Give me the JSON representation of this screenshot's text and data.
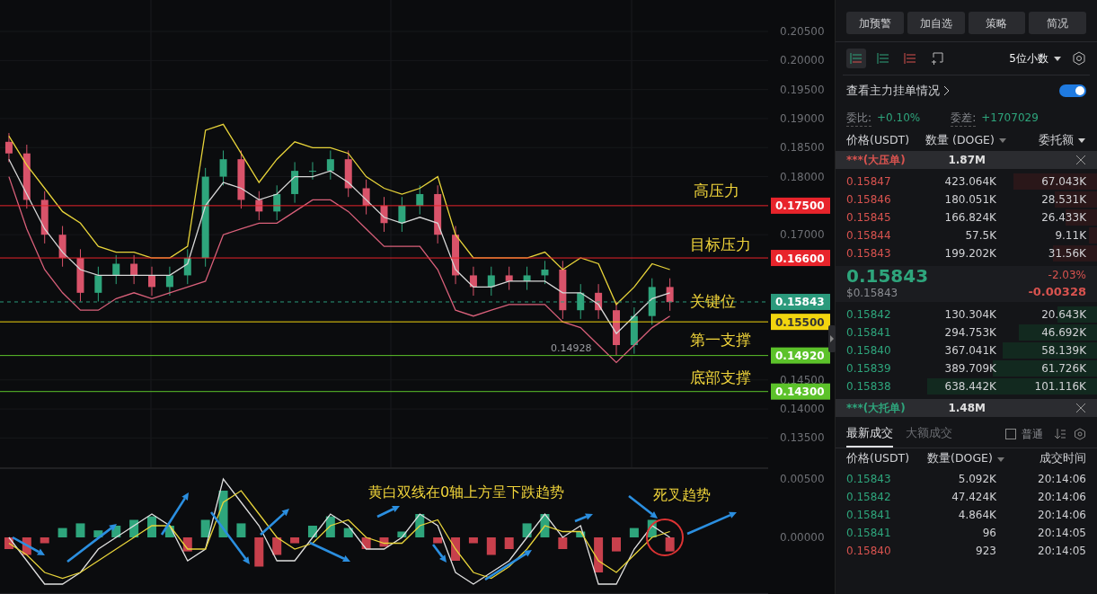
{
  "main_chart": {
    "chart_data": {
      "type": "candlestick",
      "grid": true,
      "categories": [
        null,
        null,
        null,
        null,
        null,
        null,
        null,
        null,
        null,
        null,
        null,
        null,
        null,
        null,
        null,
        null,
        null,
        null,
        null,
        null,
        null,
        null,
        null,
        null,
        null,
        null,
        null,
        null,
        null,
        null,
        null,
        null,
        null,
        null,
        null,
        null,
        null,
        null,
        null,
        null,
        null,
        null,
        null
      ],
      "ohlc": [
        [
          0.186,
          0.1875,
          0.1825,
          0.184
        ],
        [
          0.184,
          0.1855,
          0.1745,
          0.176
        ],
        [
          0.176,
          0.1775,
          0.1685,
          0.17
        ],
        [
          0.17,
          0.1715,
          0.1645,
          0.166
        ],
        [
          0.166,
          0.1675,
          0.1585,
          0.16
        ],
        [
          0.16,
          0.1645,
          0.1585,
          0.163
        ],
        [
          0.163,
          0.1665,
          0.1615,
          0.165
        ],
        [
          0.165,
          0.1665,
          0.1615,
          0.163
        ],
        [
          0.163,
          0.1645,
          0.1595,
          0.161
        ],
        [
          0.161,
          0.1645,
          0.1595,
          0.163
        ],
        [
          0.163,
          0.1675,
          0.1615,
          0.166
        ],
        [
          0.166,
          0.1815,
          0.1645,
          0.18
        ],
        [
          0.18,
          0.1845,
          0.1785,
          0.183
        ],
        [
          0.183,
          0.1845,
          0.1745,
          0.176
        ],
        [
          0.176,
          0.1775,
          0.1725,
          0.174
        ],
        [
          0.174,
          0.1785,
          0.1725,
          0.177
        ],
        [
          0.177,
          0.1825,
          0.1755,
          0.181
        ],
        [
          0.181,
          0.1825,
          0.1795,
          0.181
        ],
        [
          0.181,
          0.1845,
          0.1795,
          0.183
        ],
        [
          0.183,
          0.1845,
          0.1765,
          0.178
        ],
        [
          0.178,
          0.1795,
          0.1735,
          0.175
        ],
        [
          0.175,
          0.1765,
          0.1705,
          0.172
        ],
        [
          0.172,
          0.1765,
          0.1705,
          0.175
        ],
        [
          0.175,
          0.1785,
          0.1735,
          0.177
        ],
        [
          0.177,
          0.1785,
          0.1685,
          0.17
        ],
        [
          0.17,
          0.1715,
          0.1615,
          0.163
        ],
        [
          0.163,
          0.1645,
          0.1595,
          0.161
        ],
        [
          0.161,
          0.1645,
          0.1595,
          0.163
        ],
        [
          0.163,
          0.1645,
          0.1605,
          0.162
        ],
        [
          0.162,
          0.1645,
          0.1605,
          0.163
        ],
        [
          0.163,
          0.1655,
          0.1615,
          0.164
        ],
        [
          0.164,
          0.1655,
          0.1555,
          0.157
        ],
        [
          0.157,
          0.1615,
          0.1555,
          0.16
        ],
        [
          0.16,
          0.1615,
          0.1555,
          0.157
        ],
        [
          0.157,
          0.1585,
          0.1493,
          0.151
        ],
        [
          0.151,
          0.1575,
          0.1495,
          0.156
        ],
        [
          0.156,
          0.1625,
          0.1545,
          0.161
        ],
        [
          0.161,
          0.1625,
          0.1569,
          0.1584
        ],
        null,
        null,
        null,
        null,
        null
      ],
      "series": [
        {
          "type": "line",
          "color": "#e8d43a",
          "values": [
            0.187,
            0.182,
            0.178,
            0.174,
            0.172,
            0.168,
            0.167,
            0.167,
            0.166,
            0.166,
            0.168,
            0.188,
            0.189,
            0.184,
            0.179,
            0.183,
            0.186,
            0.185,
            0.185,
            0.184,
            0.18,
            0.178,
            0.177,
            0.178,
            0.18,
            0.17,
            0.166,
            0.166,
            0.166,
            0.166,
            0.167,
            0.164,
            0.166,
            0.165,
            0.158,
            0.161,
            0.165,
            0.164,
            null,
            null,
            null,
            null,
            null
          ]
        },
        {
          "type": "line",
          "color": "#d8d8d8",
          "values": [
            0.183,
            0.177,
            0.171,
            0.167,
            0.164,
            0.163,
            0.163,
            0.163,
            0.163,
            0.163,
            0.165,
            0.175,
            0.179,
            0.178,
            0.176,
            0.177,
            0.18,
            0.18,
            0.181,
            0.179,
            0.176,
            0.173,
            0.172,
            0.173,
            0.172,
            0.164,
            0.161,
            0.161,
            0.162,
            0.162,
            0.162,
            0.16,
            0.16,
            0.158,
            0.153,
            0.156,
            0.159,
            0.16,
            null,
            null,
            null,
            null,
            null
          ]
        },
        {
          "type": "line",
          "color": "#d9607a",
          "values": [
            0.18,
            0.171,
            0.164,
            0.16,
            0.157,
            0.157,
            0.159,
            0.16,
            0.159,
            0.16,
            0.161,
            0.162,
            0.17,
            0.171,
            0.172,
            0.172,
            0.174,
            0.176,
            0.176,
            0.174,
            0.171,
            0.168,
            0.168,
            0.168,
            0.164,
            0.157,
            0.156,
            0.157,
            0.158,
            0.158,
            0.158,
            0.155,
            0.154,
            0.151,
            0.148,
            0.151,
            0.154,
            0.156,
            null,
            null,
            null,
            null,
            null
          ]
        }
      ],
      "ylim": [
        0.13,
        0.21
      ],
      "yticks": [
        {
          "value": 0.205,
          "label": "0.20500"
        },
        {
          "value": 0.2,
          "label": "0.20000"
        },
        {
          "value": 0.195,
          "label": "0.19500"
        },
        {
          "value": 0.19,
          "label": "0.19000"
        },
        {
          "value": 0.185,
          "label": "0.18500"
        },
        {
          "value": 0.18,
          "label": "0.18000"
        },
        {
          "value": 0.17,
          "label": "0.17000"
        },
        {
          "value": 0.145,
          "label": "0.14500"
        },
        {
          "value": 0.14,
          "label": "0.14000"
        },
        {
          "value": 0.135,
          "label": "0.13500"
        }
      ],
      "ref_lines": [
        {
          "axis": "y",
          "value": 0.175,
          "label": "0.17500",
          "color": "#e8242b"
        },
        {
          "axis": "y",
          "value": 0.166,
          "label": "0.16600",
          "color": "#e8242b"
        },
        {
          "axis": "y",
          "value": 0.15843,
          "label": "0.15843",
          "color": "#2b9a7c",
          "line_style": "dashed"
        },
        {
          "axis": "y",
          "value": 0.155,
          "label": "0.15500",
          "color": "#f2d50f"
        },
        {
          "axis": "y",
          "value": 0.1492,
          "label": "0.14920",
          "color": "#5cc22a"
        },
        {
          "axis": "y",
          "value": 0.143,
          "label": "0.14300",
          "color": "#5cc22a"
        }
      ],
      "annotations": [
        "高压力",
        "目标压力",
        "关键位",
        "第一支撑",
        "底部支撑",
        "0.14928"
      ]
    }
  },
  "macd_chart": {
    "chart_data": {
      "type": "bar",
      "categories": [
        null,
        null,
        null,
        null,
        null,
        null,
        null,
        null,
        null,
        null,
        null,
        null,
        null,
        null,
        null,
        null,
        null,
        null,
        null,
        null,
        null,
        null,
        null,
        null,
        null,
        null,
        null,
        null,
        null,
        null,
        null,
        null,
        null,
        null,
        null,
        null,
        null,
        null,
        null,
        null,
        null,
        null,
        null
      ],
      "stacked": true,
      "ylim": [
        -0.0048,
        0.0059
      ],
      "series": [
        {
          "color": "#2ea57c",
          "values": [
            null,
            null,
            null,
            0.0008,
            0.0012,
            0.0006,
            0.001,
            0.0015,
            0.0018,
            0.001,
            null,
            0.0015,
            0.004,
            0.0012,
            null,
            null,
            null,
            0.001,
            0.0018,
            0.0008,
            null,
            null,
            0.0005,
            0.002,
            null,
            null,
            null,
            null,
            null,
            0.0012,
            0.002,
            null,
            0.0005,
            null,
            null,
            0.0008,
            0.0015,
            null,
            null,
            null,
            null,
            null,
            null
          ]
        },
        {
          "color": "#c8404c",
          "values": [
            -0.001,
            -0.0015,
            -0.0005,
            null,
            null,
            null,
            null,
            null,
            null,
            null,
            -0.0012,
            null,
            null,
            null,
            -0.0025,
            -0.0015,
            -0.0005,
            null,
            null,
            null,
            -0.001,
            -0.0008,
            null,
            null,
            -0.0005,
            -0.002,
            -0.0005,
            -0.0015,
            -0.001,
            null,
            null,
            -0.001,
            null,
            -0.003,
            -0.0012,
            null,
            null,
            -0.0012,
            null,
            null,
            null,
            null,
            null
          ]
        },
        {
          "type": "line",
          "color": "#e0e0e0",
          "values": [
            0,
            -0.002,
            -0.004,
            -0.004,
            -0.003,
            -0.001,
            0,
            0.001,
            0.002,
            0.001,
            -0.002,
            -0.001,
            0.005,
            0.003,
            0.001,
            -0.002,
            -0.002,
            0,
            0.002,
            0.001,
            -0.001,
            -0.001,
            0,
            0.002,
            0.001,
            -0.003,
            -0.004,
            -0.003,
            -0.002,
            0,
            0.002,
            0,
            0.001,
            -0.004,
            -0.004,
            -0.001,
            0.001,
            0,
            null,
            null,
            null,
            null,
            null
          ]
        },
        {
          "type": "line",
          "color": "#e8d43a",
          "values": [
            -0.0005,
            -0.0015,
            -0.003,
            -0.0035,
            -0.003,
            -0.002,
            -0.001,
            0,
            0.001,
            0.001,
            -0.001,
            -0.001,
            0.003,
            0.004,
            0.002,
            0,
            -0.001,
            -0.0005,
            0.001,
            0.0015,
            0,
            -0.0005,
            -0.0005,
            0.001,
            0.0015,
            -0.001,
            -0.003,
            -0.0035,
            -0.0025,
            -0.001,
            0.001,
            0.0005,
            0.0005,
            -0.002,
            -0.003,
            -0.0015,
            0,
            0.0005,
            null,
            null,
            null,
            null,
            null
          ]
        }
      ],
      "yticks": [
        {
          "value": 0.005,
          "label": "0.00500"
        },
        {
          "value": 0,
          "label": "0.00000"
        }
      ],
      "annotations": [
        "黄白双线在0轴上方呈下跌趋势",
        "死叉趋势"
      ]
    }
  },
  "panel": {
    "buttons": [
      "加预警",
      "加自选",
      "策略",
      "简况"
    ],
    "views": [
      {
        "selected": true
      },
      {
        "selected": false
      },
      {
        "selected": false
      },
      {
        "selected": false
      }
    ],
    "precision": "5位小数",
    "main_force": {
      "label": "查看主力挂单情况",
      "on": true
    },
    "ratio": {
      "label": "委比:",
      "value": "+0.10%"
    },
    "diff": {
      "label": "委差:",
      "value": "+1707029"
    },
    "book_columns": [
      "价格(USDT)",
      "数量 (DOGE)",
      "委托额"
    ],
    "big_ask": {
      "label": "***(大压单)",
      "value": "1.87M"
    },
    "asks": [
      {
        "price": "0.15847",
        "amount": "423.064K",
        "total": "67.043K",
        "level": 0.32
      },
      {
        "price": "0.15846",
        "amount": "180.051K",
        "total": "28.531K",
        "level": 0.16
      },
      {
        "price": "0.15845",
        "amount": "166.824K",
        "total": "26.433K",
        "level": 0.12
      },
      {
        "price": "0.15844",
        "amount": "57.5K",
        "total": "9.11K",
        "level": 0.03
      },
      {
        "price": "0.15843",
        "amount": "199.202K",
        "total": "31.56K",
        "level": 0.17
      }
    ],
    "last": {
      "price": "0.15843",
      "usd": "$0.15843",
      "change_pct": "-2.03%",
      "change": "-0.00328"
    },
    "bids": [
      {
        "price": "0.15842",
        "amount": "130.304K",
        "total": "20.643K",
        "level": 0.15
      },
      {
        "price": "0.15841",
        "amount": "294.753K",
        "total": "46.692K",
        "level": 0.3
      },
      {
        "price": "0.15840",
        "amount": "367.041K",
        "total": "58.139K",
        "level": 0.36
      },
      {
        "price": "0.15839",
        "amount": "389.709K",
        "total": "61.726K",
        "level": 0.4
      },
      {
        "price": "0.15838",
        "amount": "638.442K",
        "total": "101.116K",
        "level": 0.65
      }
    ],
    "big_bid": {
      "label": "***(大托单)",
      "value": "1.48M"
    },
    "trade_tabs": [
      {
        "label": "最新成交",
        "selected": true
      },
      {
        "label": "大额成交",
        "selected": false
      }
    ],
    "normal": {
      "label": "普通",
      "checked": false
    },
    "trade_columns": [
      "价格(USDT)",
      "数量(DOGE)",
      "成交时间"
    ],
    "trades": [
      {
        "price": "0.15843",
        "amount": "5.092K",
        "time": "20:14:06",
        "color": "#2ea57c"
      },
      {
        "price": "0.15842",
        "amount": "47.424K",
        "time": "20:14:06",
        "color": "#2ea57c"
      },
      {
        "price": "0.15841",
        "amount": "4.864K",
        "time": "20:14:06",
        "color": "#2ea57c"
      },
      {
        "price": "0.15841",
        "amount": "96",
        "time": "20:14:05",
        "color": "#2ea57c"
      },
      {
        "price": "0.15840",
        "amount": "923",
        "time": "20:14:05",
        "color": "#d9534f"
      }
    ]
  }
}
